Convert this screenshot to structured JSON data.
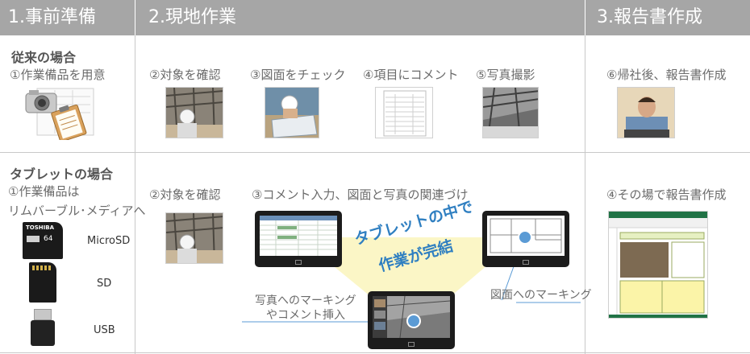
{
  "headers": {
    "prep": "1.事前準備",
    "field": "2.現地作業",
    "report": "3.報告書作成"
  },
  "conventional": {
    "title": "従来の場合",
    "prep_step": "①作業備品を用意",
    "steps": [
      "②対象を確認",
      "③図面をチェック",
      "④項目にコメント",
      "⑤写真撮影"
    ],
    "report_step": "⑥帰社後、報告書作成"
  },
  "tablet_case": {
    "title": "タブレットの場合",
    "prep_step_line1": "①作業備品は",
    "prep_step_line2": "リムバーブル･メディアへ",
    "media": [
      "MicroSD",
      "SD",
      "USB"
    ],
    "sd_brand": "TOSHIBA",
    "sd_capacity": "64",
    "steps": [
      "②対象を確認",
      "③コメント入力、図面と写真の関連づけ"
    ],
    "center_text_line1": "タブレットの中で",
    "center_text_line2": "作業が完結",
    "photo_marking_line1": "写真へのマーキング",
    "photo_marking_line2": "やコメント挿入",
    "drawing_marking": "図面へのマーキング",
    "report_step": "④その場で報告書作成"
  },
  "colors": {
    "header_bg": "#a6a6a6",
    "highlight": "#fbf6c6",
    "marker_blue": "#5b9bd5",
    "slogan_blue": "#2f7fc1"
  }
}
